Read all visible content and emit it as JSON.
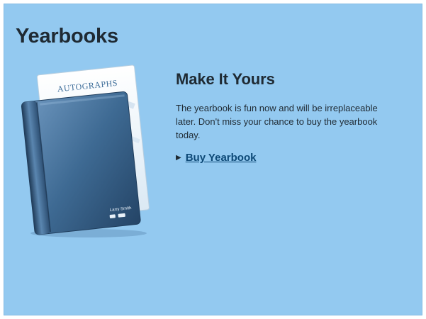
{
  "page": {
    "title": "Yearbooks"
  },
  "promo": {
    "heading": "Make It Yours",
    "description": "The yearbook is fun now and will be irreplaceable later. Don't miss your chance to buy the yearbook today.",
    "cta_label": "Buy Yearbook",
    "cta_icon": "play-triangle-icon"
  },
  "book": {
    "cover_text": "AUTOGRAPHS",
    "owner_name": "Larry Smith",
    "cover_color": "#3e6a93"
  },
  "colors": {
    "panel_background": "#93c9f0",
    "text": "#1f2a33",
    "link": "#0c4876"
  }
}
